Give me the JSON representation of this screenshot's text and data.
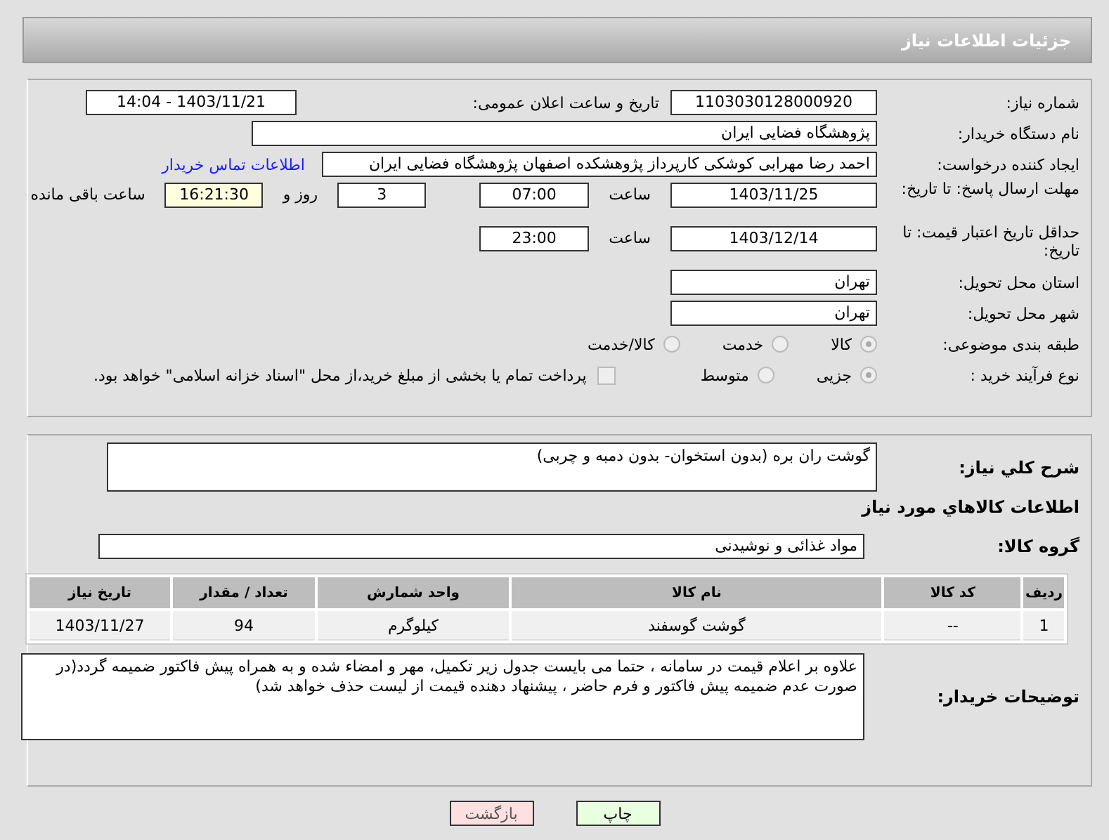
{
  "header": {
    "title": "جزئیات اطلاعات نیاز"
  },
  "need_number": {
    "label": "شماره نیاز:",
    "value": "1103030128000920"
  },
  "announce": {
    "label": "تاریخ و ساعت اعلان عمومی:",
    "value": "1403/11/21 - 14:04"
  },
  "buyer": {
    "label": "نام دستگاه خریدار:",
    "value": "پژوهشگاه فضایی ایران"
  },
  "creator": {
    "label": "ایجاد کننده درخواست:",
    "value": "احمد رضا مهرابی کوشکی کارپرداز پژوهشکده اصفهان پژوهشگاه فضایی ایران",
    "link": "اطلاعات تماس خریدار"
  },
  "deadline": {
    "label": "مهلت ارسال پاسخ: تا تاریخ:",
    "date": "1403/11/25",
    "time_label": "ساعت",
    "time": "07:00",
    "days": "3",
    "days_label": "روز و",
    "remaining": "16:21:30",
    "remaining_label": "ساعت باقی مانده"
  },
  "validity": {
    "label": "حداقل تاریخ اعتبار قیمت: تا تاریخ:",
    "date": "1403/12/14",
    "time_label": "ساعت",
    "time": "23:00"
  },
  "province": {
    "label": "استان محل تحویل:",
    "value": "تهران"
  },
  "city": {
    "label": "شهر محل تحویل:",
    "value": "تهران"
  },
  "category": {
    "label": "طبقه بندی موضوعی:",
    "options": [
      {
        "label": "کالا",
        "selected": true
      },
      {
        "label": "خدمت",
        "selected": false
      },
      {
        "label": "کالا/خدمت",
        "selected": false
      }
    ]
  },
  "process": {
    "label": "نوع فرآیند خرید :",
    "options": [
      {
        "label": "جزیی",
        "selected": true
      },
      {
        "label": "متوسط",
        "selected": false
      }
    ],
    "payment": {
      "label": "پرداخت تمام یا بخشی از مبلغ خرید،از محل \"اسناد خزانه اسلامی\" خواهد بود.",
      "checked": false
    }
  },
  "description": {
    "label": "شرح کلي نياز:",
    "value": "گوشت ران بره (بدون استخوان- بدون دمبه و چربی)"
  },
  "goods_heading": "اطلاعات کالاهاي مورد نياز",
  "goods_group": {
    "label": "گروه کالا:",
    "value": "مواد غذائی و نوشیدنی"
  },
  "table": {
    "columns": [
      "ردیف",
      "کد کالا",
      "نام کالا",
      "واحد شمارش",
      "تعداد / مقدار",
      "تاریخ نیاز"
    ],
    "rows": [
      [
        "1",
        "--",
        "گوشت گوسفند",
        "کیلوگرم",
        "94",
        "1403/11/27"
      ]
    ]
  },
  "notes": {
    "label": "توضیحات خریدار:",
    "value": "علاوه بر اعلام قیمت در سامانه ، حتما می بایست جدول زیر تکمیل، مهر و امضاء شده و به همراه پیش فاکتور ضمیمه گردد(در صورت عدم ضمیمه پیش فاکتور و فرم حاضر ، پیشنهاد دهنده قیمت از لیست حذف خواهد شد)"
  },
  "buttons": [
    {
      "label": "چاپ",
      "kind": "print"
    },
    {
      "label": "بازگشت",
      "kind": "back"
    }
  ]
}
